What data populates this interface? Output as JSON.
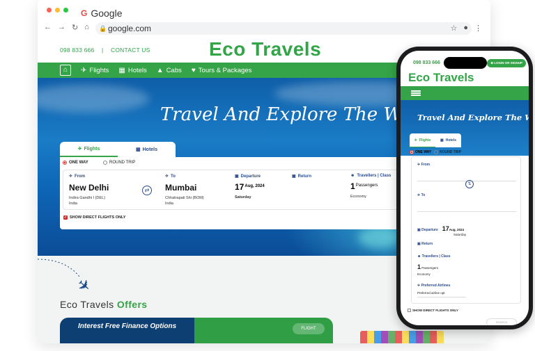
{
  "browser": {
    "tab_title": "Google",
    "url": "google.com",
    "traffic_colors": [
      "#fe5f57",
      "#febc2e",
      "#28c840"
    ]
  },
  "site": {
    "phone_number": "098 833 666",
    "separator": "|",
    "contact_label": "CONTACT US",
    "brand": "Eco Travels",
    "nav": [
      {
        "label": "Flights",
        "icon": "plane-icon"
      },
      {
        "label": "Hotels",
        "icon": "hotel-icon"
      },
      {
        "label": "Cabs",
        "icon": "car-icon"
      },
      {
        "label": "Tours & Packages",
        "icon": "heart-icon"
      }
    ],
    "hero_title": "Travel And Explore The World",
    "search": {
      "tabs": [
        "Flights",
        "Hotels"
      ],
      "one_way": "ONE WAY",
      "round_trip": "ROUND TRIP",
      "from_label": "From",
      "from_city": "New Delhi",
      "from_airport": "Indira Gandhi I (DEL)",
      "from_country": "India",
      "to_label": "To",
      "to_city": "Mumbai",
      "to_airport": "Chhatrapati Shi (BOM)",
      "to_country": "India",
      "departure_label": "Departure",
      "departure_day": "17",
      "departure_month": "Aug, 2024",
      "departure_weekday": "Saturday",
      "return_label": "Return",
      "travellers_label": "Travellers | Class",
      "passengers_count": "1",
      "passengers_label": "Passengers",
      "class": "Economy",
      "direct_flights": "SHOW DIRECT FLIGHTS ONLY"
    },
    "offers": {
      "title_prefix": "Eco Travels",
      "title_suffix": "Offers",
      "card_title": "Interest Free Finance Options",
      "card_button": "FLIGHT"
    }
  },
  "phone": {
    "login_label": "LOGIN OR SIGNUP",
    "brand": "Eco Travels",
    "hero_title": "Travel And Explore The World",
    "tabs": [
      "Flights",
      "Hotels"
    ],
    "one_way": "ONE WAY",
    "round_trip": "ROUND TRIP",
    "from_label": "From",
    "to_label": "To",
    "departure_label": "Departure",
    "departure_day": "17",
    "departure_month": "Aug, 2024",
    "departure_weekday": "Saturday",
    "return_label": "Return",
    "travellers_label": "Travellers | Class",
    "passengers_count": "1",
    "passengers_label": "Passengers",
    "class": "Economy",
    "airline_label": "Preferred Airlines",
    "airline_placeholder": "Preferred airline opt",
    "direct_flights": "SHOW DIRECT FLIGHTS ONLY",
    "search_button": "SEARCH"
  },
  "colors": {
    "brand_green": "#35a347",
    "nav_text": "#2a4b8d",
    "offer_blue": "#0d3f73"
  }
}
